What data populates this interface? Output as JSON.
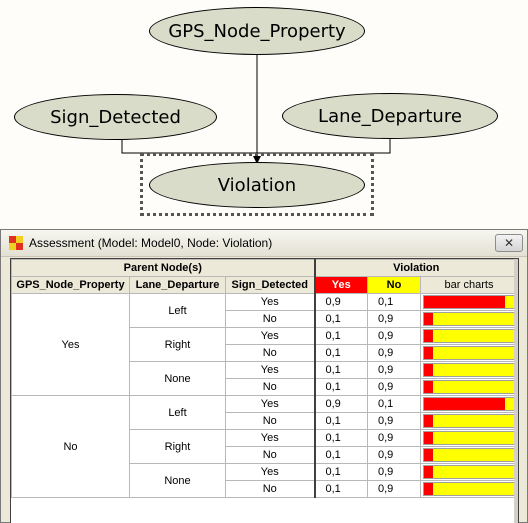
{
  "graph": {
    "nodes": {
      "gps": "GPS_Node_Property",
      "sign": "Sign_Detected",
      "lane": "Lane_Departure",
      "violation": "Violation"
    }
  },
  "window": {
    "title": "Assessment (Model: Model0,  Node: Violation)",
    "close_label": "✕"
  },
  "table": {
    "parent_header": "Parent Node(s)",
    "child_header": "Violation",
    "columns": [
      "GPS_Node_Property",
      "Lane_Departure",
      "Sign_Detected"
    ],
    "states": [
      "Yes",
      "No"
    ],
    "bar_header": "bar charts",
    "colors": {
      "yes": "#ff0000",
      "no": "#ffff00"
    },
    "rows": [
      {
        "gps": "Yes",
        "lane": "Left",
        "sign": "Yes",
        "yes": "0,9",
        "no": "0,1"
      },
      {
        "gps": "Yes",
        "lane": "Left",
        "sign": "No",
        "yes": "0,1",
        "no": "0,9"
      },
      {
        "gps": "Yes",
        "lane": "Right",
        "sign": "Yes",
        "yes": "0,1",
        "no": "0,9"
      },
      {
        "gps": "Yes",
        "lane": "Right",
        "sign": "No",
        "yes": "0,1",
        "no": "0,9"
      },
      {
        "gps": "Yes",
        "lane": "None",
        "sign": "Yes",
        "yes": "0,1",
        "no": "0,9"
      },
      {
        "gps": "Yes",
        "lane": "None",
        "sign": "No",
        "yes": "0,1",
        "no": "0,9"
      },
      {
        "gps": "No",
        "lane": "Left",
        "sign": "Yes",
        "yes": "0,9",
        "no": "0,1"
      },
      {
        "gps": "No",
        "lane": "Left",
        "sign": "No",
        "yes": "0,1",
        "no": "0,9"
      },
      {
        "gps": "No",
        "lane": "Right",
        "sign": "Yes",
        "yes": "0,1",
        "no": "0,9"
      },
      {
        "gps": "No",
        "lane": "Right",
        "sign": "No",
        "yes": "0,1",
        "no": "0,9"
      },
      {
        "gps": "No",
        "lane": "None",
        "sign": "Yes",
        "yes": "0,1",
        "no": "0,9"
      },
      {
        "gps": "No",
        "lane": "None",
        "sign": "No",
        "yes": "0,1",
        "no": "0,9"
      }
    ]
  }
}
